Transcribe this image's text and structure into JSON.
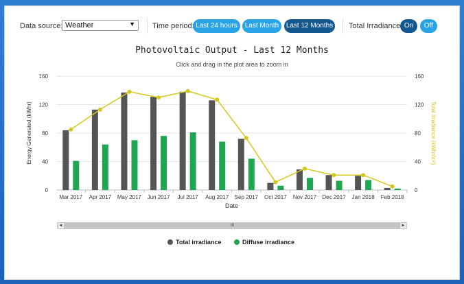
{
  "toolbar": {
    "data_source_label": "Data source:",
    "data_source_value": "Weather",
    "data_source_caret": "▼",
    "time_period_label": "Time period:",
    "periods": [
      {
        "label": "Last 24 hours",
        "active": false
      },
      {
        "label": "Last Month",
        "active": false
      },
      {
        "label": "Last 12 Months",
        "active": true
      }
    ],
    "irradiance_label": "Total Irradiance:",
    "irradiance_options": [
      {
        "label": "On",
        "active": true
      },
      {
        "label": "Off",
        "active": false
      }
    ]
  },
  "colors": {
    "pill": "#2aa3e6",
    "pill_active": "#13578f",
    "total_bar": "#555555",
    "diffuse_bar": "#1ea652",
    "irradiance_line": "#d4c81a"
  },
  "scrollbar": {
    "grip": "III",
    "left_arrow": "◄",
    "right_arrow": "►"
  },
  "legend": [
    {
      "name": "Total irradiance",
      "color": "#555555"
    },
    {
      "name": "Diffuse irradiance",
      "color": "#1ea652"
    }
  ],
  "chart_data": {
    "type": "bar",
    "title": "Photovoltaic Output - Last 12 Months",
    "subtitle": "Click and drag in the plot area to zoom in",
    "xlabel": "Date",
    "ylabel": "Energy Generated (kWhr)",
    "y2label": "Total Irradiance (kWhr/m²)",
    "ylim": [
      0,
      160
    ],
    "y2lim": [
      0,
      160
    ],
    "yticks": [
      "0",
      "40",
      "80",
      "120",
      "160"
    ],
    "y2ticks": [
      "0",
      "40",
      "80",
      "120",
      "160"
    ],
    "grid": true,
    "legend_position": "bottom",
    "categories": [
      "Mar 2017",
      "Apr 2017",
      "May 2017",
      "Jun 2017",
      "Jul 2017",
      "Aug 2017",
      "Sep 2017",
      "Oct 2017",
      "Nov 2017",
      "Dec 2017",
      "Jan 2018",
      "Feb 2018"
    ],
    "series": [
      {
        "name": "Total irradiance",
        "kind": "bar",
        "values": [
          84,
          113,
          137,
          131,
          138,
          126,
          72,
          10,
          29,
          21,
          20,
          3
        ]
      },
      {
        "name": "Diffuse irradiance",
        "kind": "bar",
        "values": [
          41,
          64,
          70,
          76,
          81,
          68,
          44,
          6,
          17,
          13,
          14,
          2
        ]
      },
      {
        "kind": "line",
        "axis": "right",
        "values": [
          85,
          113,
          138,
          130,
          139,
          127,
          73,
          11,
          30,
          21,
          21,
          5
        ]
      }
    ]
  }
}
